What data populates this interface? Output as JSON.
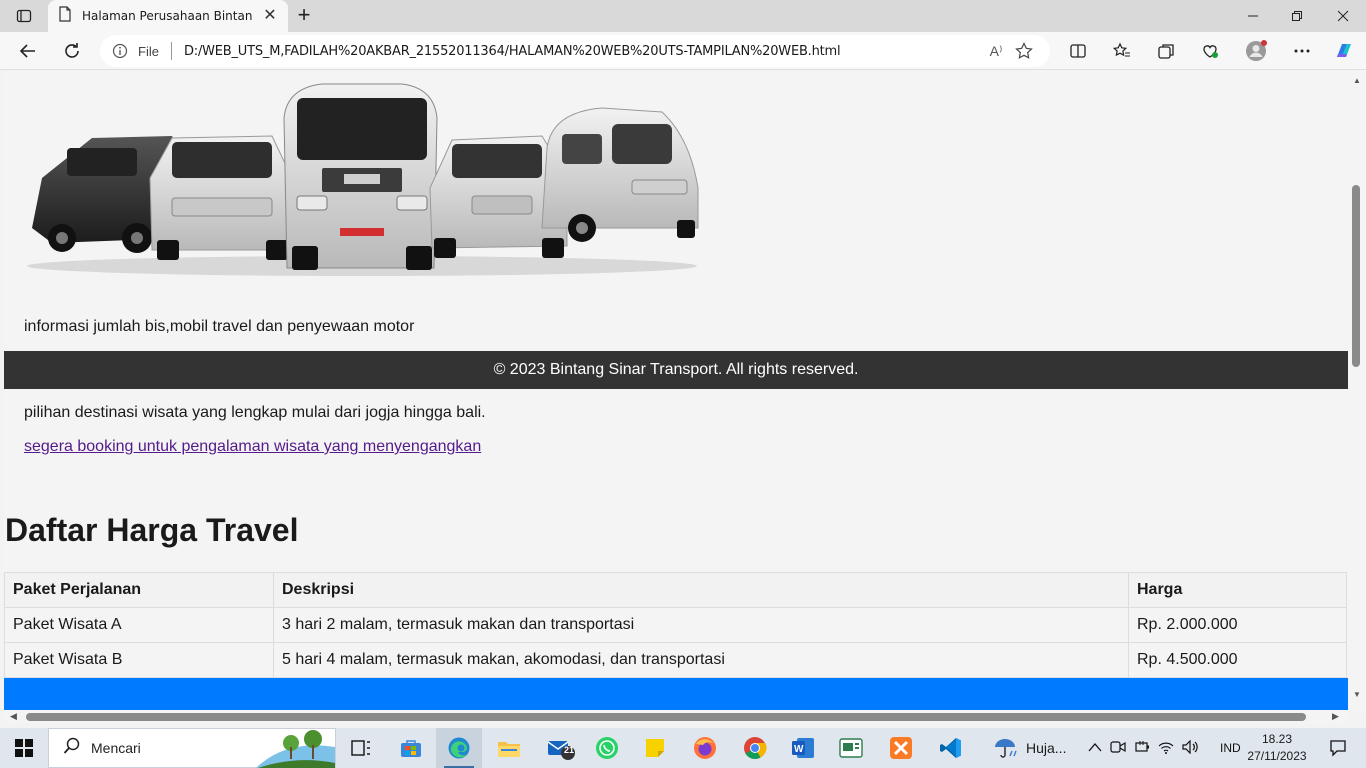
{
  "browser": {
    "tab_title": "Halaman Perusahaan Bintang sinar",
    "address_scheme_label": "File",
    "url": "D:/WEB_UTS_M,FADILAH%20AKBAR_21552011364/HALAMAN%20WEB%20UTS-TAMPILAN%20WEB.html",
    "read_aloud_label": "A⁾"
  },
  "page": {
    "intro_text": "informasi jumlah bis,mobil travel dan penyewaan motor",
    "footer_text": "© 2023 Bintang Sinar Transport. All rights reserved.",
    "destination_text": "pilihan destinasi wisata yang lengkap mulai dari jogja hingga bali.",
    "booking_link": "segera booking untuk pengalaman wisata yang menyengangkan",
    "price_title": "Daftar Harga Travel",
    "table": {
      "headers": [
        "Paket Perjalanan",
        "Deskripsi",
        "Harga"
      ],
      "rows": [
        [
          "Paket Wisata A",
          "3 hari 2 malam, termasuk makan dan transportasi",
          "Rp. 2.000.000"
        ],
        [
          "Paket Wisata B",
          "5 hari 4 malam, termasuk makan, akomodasi, dan transportasi",
          "Rp. 4.500.000"
        ]
      ]
    },
    "colors": {
      "footer": "#333333",
      "blue_bar": "#007bff",
      "link": "#551a8b"
    }
  },
  "taskbar": {
    "search_placeholder": "Mencari",
    "mail_badge": "21",
    "weather_text": "Huja...",
    "language": "IND",
    "time": "18.23",
    "date": "27/11/2023"
  }
}
